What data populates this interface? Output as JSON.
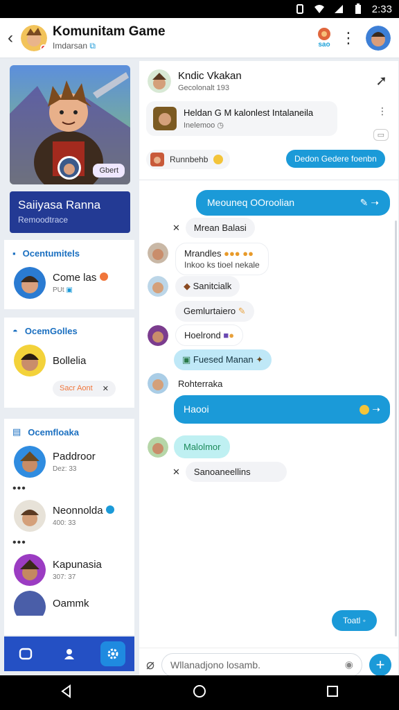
{
  "status": {
    "time": "2:33"
  },
  "topbar": {
    "title": "Komunitam Game",
    "subtitle": "Imdarsan",
    "badge_label": "sao"
  },
  "left": {
    "hero_button": "Gbert",
    "profile": {
      "name": "Saiiyasa Ranna",
      "sub": "Remoodtrace"
    },
    "groups": [
      {
        "header": "Ocentumitels",
        "contacts": [
          {
            "name": "Come las",
            "meta": "PUt"
          }
        ]
      },
      {
        "header": "OcemGolles",
        "contacts": [
          {
            "name": "Bollelia",
            "chip": "Sacr Aont"
          }
        ]
      },
      {
        "header": "Ocemfloaka",
        "contacts": [
          {
            "name": "Paddroor",
            "meta": "Dez: 33"
          },
          {
            "name": "Neonnolda",
            "meta": "400: 33"
          },
          {
            "name": "Kapunasia",
            "meta": "307: 37"
          },
          {
            "name": "Oammk"
          }
        ]
      }
    ]
  },
  "right": {
    "header": {
      "user_name": "Kndic Vkakan",
      "user_sub": "Gecolonalt 193",
      "pinned_title": "Heldan G M kalonlest Intalaneila",
      "pinned_sub": "Inelemoo",
      "tag1": "Runnbehb",
      "tag2": "Dedon Gedere foenbn"
    },
    "messages": [
      {
        "text": "Meouneq OOroolian",
        "type": "out"
      },
      {
        "text": "Mrean Balasi",
        "type": "dismiss"
      },
      {
        "text": "Mrandles",
        "line2": "Inkoo ks tioel nekale",
        "type": "in"
      },
      {
        "text": "Sanitcialk",
        "type": "in"
      },
      {
        "text": "Gemlurtaiero",
        "type": "in"
      },
      {
        "text": "Hoelrond",
        "type": "in"
      },
      {
        "text": "Fuesed Manan",
        "type": "in"
      },
      {
        "text": "Rohterraka",
        "type": "in"
      },
      {
        "text": "Haooi",
        "type": "out"
      },
      {
        "text": "Malolmor",
        "type": "in"
      },
      {
        "text": "Sanoaneellins",
        "type": "dismiss"
      }
    ],
    "floating_pill": "Toatl",
    "composer_placeholder": "Wllanadjono losamb."
  },
  "colors": {
    "accent": "#1b9ad8",
    "profile": "#233a94",
    "tabbar": "#2450c4"
  }
}
